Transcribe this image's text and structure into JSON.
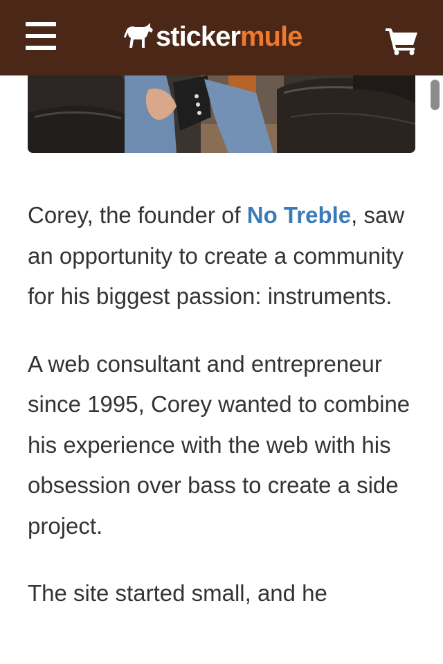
{
  "header": {
    "menu_icon": "hamburger-icon",
    "logo": {
      "part1": "sticker",
      "part2": "mule",
      "mark_icon": "mule-icon"
    },
    "cart_icon": "cart-icon"
  },
  "colors": {
    "header_bg": "#4a2717",
    "logo_accent": "#ee7a2f",
    "link": "#3b7ab8",
    "body_text": "#333333"
  },
  "article": {
    "p1": {
      "before": "Corey, the founder of ",
      "link": "No Treble",
      "after": ", saw an opportunity to create a community for his biggest passion: instruments."
    },
    "p2": "A web consultant and entrepreneur since 1995, Corey wanted to combine his experience with the web with his obsession over bass to create a side project.",
    "p3": "The site started small, and he"
  }
}
